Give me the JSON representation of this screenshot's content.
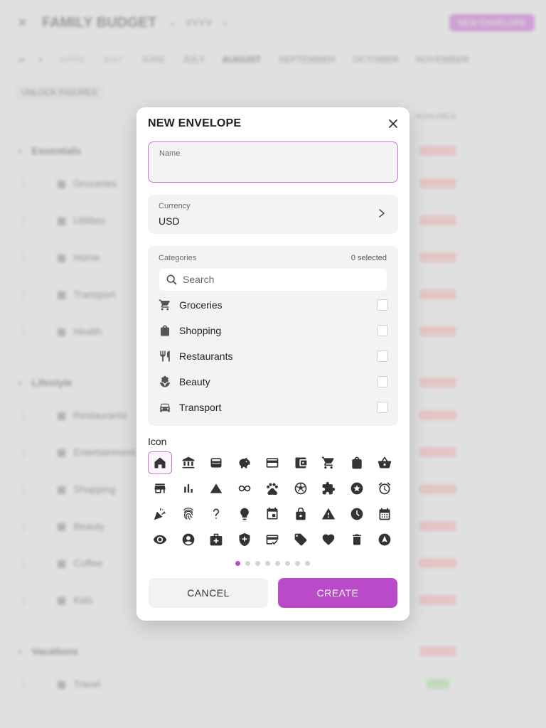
{
  "background": {
    "title": "FAMILY BUDGET",
    "year": "YYYY",
    "new_button": "NEW ENVELOPE",
    "months": [
      "APRIL",
      "MAY",
      "JUNE",
      "JULY",
      "AUGUST",
      "SEPTEMBER",
      "OCTOBER",
      "NOVEMBER"
    ],
    "unlock_button": "UNLOCK FIGURES",
    "available_label": "AVAILABLE",
    "groups": [
      {
        "name": "Essentials",
        "rows": [
          "Groceries",
          "Utilities",
          "Home",
          "Transport",
          "Health"
        ]
      },
      {
        "name": "Lifestyle",
        "rows": [
          "Restaurants",
          "Entertainment",
          "Shopping",
          "Beauty",
          "Coffee",
          "Kids"
        ]
      },
      {
        "name": "Vacations",
        "rows": [
          "Travel"
        ]
      }
    ]
  },
  "dialog": {
    "title": "NEW ENVELOPE",
    "name_label": "Name",
    "name_value": "",
    "currency_label": "Currency",
    "currency_value": "USD",
    "categories_label": "Categories",
    "categories_count": "0 selected",
    "search_placeholder": "Search",
    "categories": [
      {
        "label": "Groceries",
        "icon": "cart-icon"
      },
      {
        "label": "Shopping",
        "icon": "shopping-bag-icon"
      },
      {
        "label": "Restaurants",
        "icon": "fork-knife-icon"
      },
      {
        "label": "Beauty",
        "icon": "spa-icon"
      },
      {
        "label": "Transport",
        "icon": "car-icon"
      }
    ],
    "icon_label": "Icon",
    "icon_page": 1,
    "icon_pages": 8,
    "cancel_label": "CANCEL",
    "create_label": "CREATE",
    "accent": "#b94ac8"
  }
}
